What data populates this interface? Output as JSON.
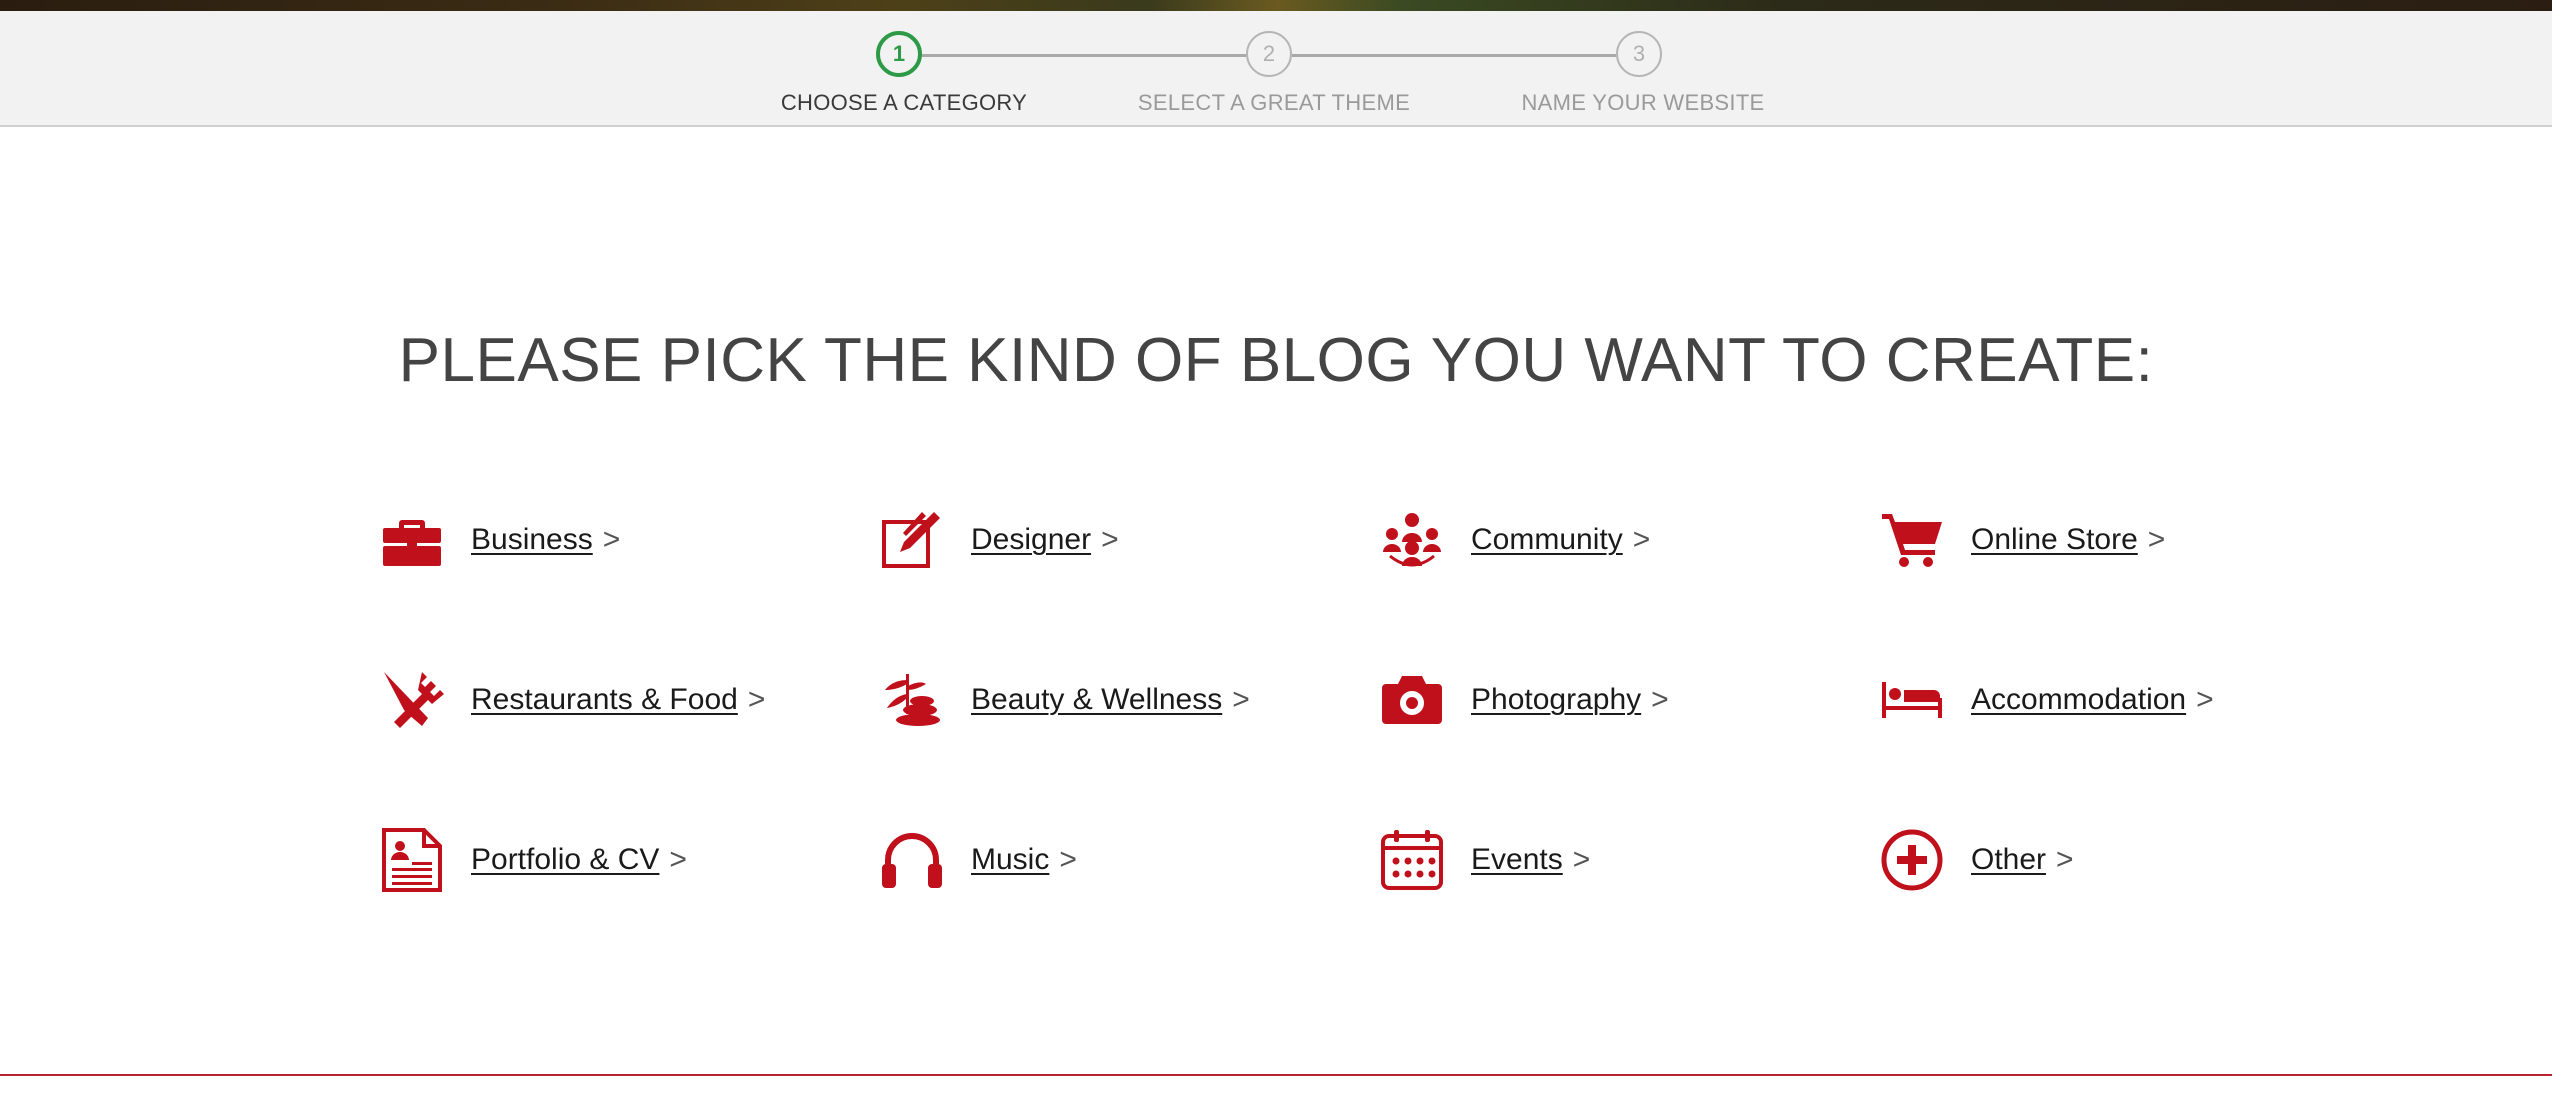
{
  "steps": [
    {
      "number": "1",
      "label": "CHOOSE A CATEGORY"
    },
    {
      "number": "2",
      "label": "SELECT A GREAT THEME"
    },
    {
      "number": "3",
      "label": "NAME YOUR WEBSITE"
    }
  ],
  "headline": "PLEASE PICK THE KIND OF BLOG YOU WANT TO CREATE:",
  "categories": [
    {
      "label": "Business",
      "chevron": ">",
      "icon": "briefcase-icon"
    },
    {
      "label": "Designer",
      "chevron": ">",
      "icon": "pen-drawing-icon"
    },
    {
      "label": "Community",
      "chevron": ">",
      "icon": "people-group-icon"
    },
    {
      "label": "Online Store",
      "chevron": ">",
      "icon": "shopping-cart-icon"
    },
    {
      "label": "Restaurants & Food",
      "chevron": ">",
      "icon": "knife-fork-icon"
    },
    {
      "label": "Beauty & Wellness",
      "chevron": ">",
      "icon": "spa-stones-icon"
    },
    {
      "label": "Photography",
      "chevron": ">",
      "icon": "camera-icon"
    },
    {
      "label": "Accommodation",
      "chevron": ">",
      "icon": "bed-icon"
    },
    {
      "label": "Portfolio & CV",
      "chevron": ">",
      "icon": "resume-document-icon"
    },
    {
      "label": "Music",
      "chevron": ">",
      "icon": "headphones-icon"
    },
    {
      "label": "Events",
      "chevron": ">",
      "icon": "calendar-icon"
    },
    {
      "label": "Other",
      "chevron": ">",
      "icon": "plus-circle-icon"
    }
  ],
  "colors": {
    "accent_red": "#c0101c",
    "step_active_green": "#2e9a48",
    "heading_gray": "#444444"
  }
}
